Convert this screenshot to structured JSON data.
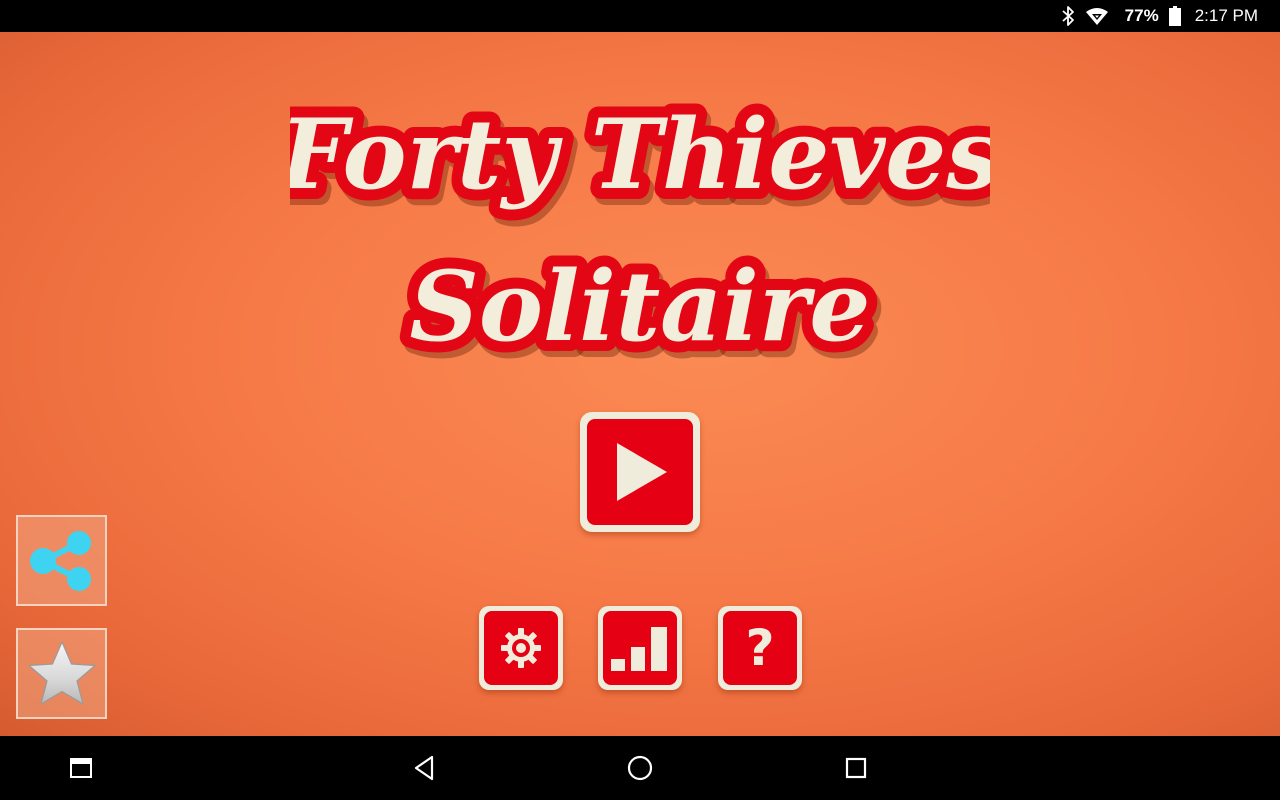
{
  "status_bar": {
    "icons": [
      "bluetooth-icon",
      "wifi-icon",
      "battery-icon"
    ],
    "battery_percent": "77%",
    "time": "2:17 PM"
  },
  "game": {
    "title_line1": "Forty Thieves",
    "title_line2": "Solitaire",
    "play_icon": "play-icon",
    "buttons": [
      {
        "name": "settings",
        "icon": "gear-icon"
      },
      {
        "name": "statistics",
        "icon": "bar-chart-icon"
      },
      {
        "name": "help",
        "icon": "question-mark-icon",
        "glyph": "?"
      }
    ],
    "side_buttons": [
      {
        "name": "share",
        "icon": "share-icon"
      },
      {
        "name": "rate",
        "icon": "star-icon"
      }
    ]
  },
  "nav_bar": {
    "buttons": [
      "app-window-icon",
      "back-icon",
      "home-icon",
      "overview-icon"
    ]
  },
  "colors": {
    "background": "#f67a47",
    "button_red": "#e60014",
    "button_cream": "#f0ecdc",
    "title_cream": "#f3eedc",
    "title_outline": "#e30615",
    "share_blue": "#3fd3f2"
  }
}
